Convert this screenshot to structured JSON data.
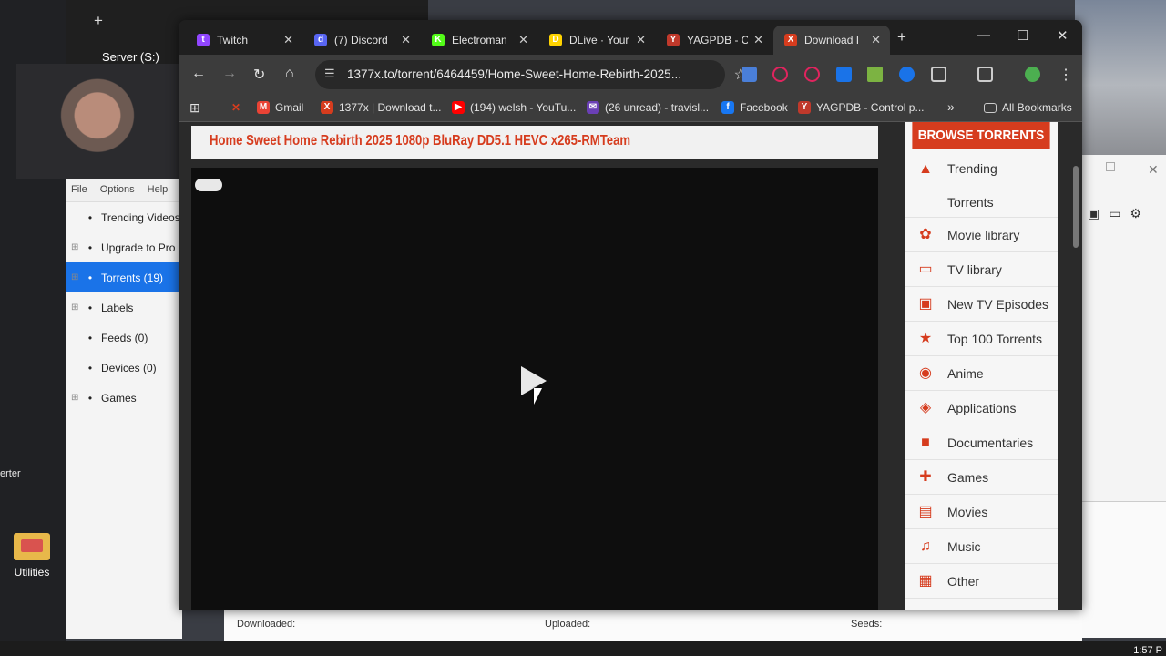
{
  "desktop": {
    "utilities_label": "Utilities",
    "erter_text": "erter",
    "server_label": "Server (S:)"
  },
  "utorrent": {
    "menu": [
      "File",
      "Options",
      "Help"
    ],
    "items": [
      {
        "label": "Trending Videos",
        "icon": "lightning-icon",
        "expand": ""
      },
      {
        "label": "Upgrade to Pro",
        "icon": "utorrent-icon",
        "expand": "⊞"
      },
      {
        "label": "Torrents (19)",
        "icon": "torrents-icon",
        "expand": "⊞",
        "selected": true
      },
      {
        "label": "Labels",
        "icon": "tag-icon",
        "expand": "⊞"
      },
      {
        "label": "Feeds (0)",
        "icon": "rss-icon",
        "expand": ""
      },
      {
        "label": "Devices (0)",
        "icon": "device-icon",
        "expand": ""
      },
      {
        "label": "Games",
        "icon": "gamepad-icon",
        "expand": "⊞"
      }
    ]
  },
  "details": {
    "downloaded": "Downloaded:",
    "uploaded": "Uploaded:",
    "seeds": "Seeds:"
  },
  "browser": {
    "tabs": [
      {
        "title": "Twitch",
        "color": "#9146ff",
        "glyph": "t"
      },
      {
        "title": "(7) Discord",
        "color": "#5865f2",
        "glyph": "d"
      },
      {
        "title": "Electroman",
        "color": "#53fc18",
        "glyph": "K"
      },
      {
        "title": "DLive · Your",
        "color": "#ffd300",
        "glyph": "D"
      },
      {
        "title": "YAGPDB - C",
        "color": "#c0392b",
        "glyph": "Y"
      },
      {
        "title": "Download I",
        "color": "#d63c1e",
        "glyph": "X",
        "active": true
      }
    ],
    "url": "1377x.to/torrent/6464459/Home-Sweet-Home-Rebirth-2025...",
    "bookmarks": [
      {
        "label": "Gmail",
        "color": "#ea4335",
        "glyph": "M"
      },
      {
        "label": "1377x | Download t...",
        "color": "#d63c1e",
        "glyph": "X"
      },
      {
        "label": "(194) welsh - YouTu...",
        "color": "#ff0000",
        "glyph": "▶"
      },
      {
        "label": "(26 unread) - travisl...",
        "color": "#6a3fb5",
        "glyph": "✉"
      },
      {
        "label": "Facebook",
        "color": "#1877f2",
        "glyph": "f"
      },
      {
        "label": "YAGPDB - Control p...",
        "color": "#c0392b",
        "glyph": "Y"
      }
    ],
    "all_bookmarks": "All Bookmarks"
  },
  "page": {
    "torrent_title": "Home Sweet Home Rebirth 2025 1080p BluRay DD5.1 HEVC x265-RMTeam",
    "browse_header": "BROWSE TORRENTS",
    "categories": [
      {
        "label": "Trending Torrents",
        "icon": "trending-chart-icon",
        "glyph": "▲"
      },
      {
        "label": "Movie library",
        "icon": "film-reel-icon",
        "glyph": "✿"
      },
      {
        "label": "TV library",
        "icon": "tv-icon",
        "glyph": "▭"
      },
      {
        "label": "New TV Episodes",
        "icon": "new-tv-icon",
        "glyph": "▣"
      },
      {
        "label": "Top 100 Torrents",
        "icon": "top-badge-icon",
        "glyph": "★"
      },
      {
        "label": "Anime",
        "icon": "anime-icon",
        "glyph": "◉"
      },
      {
        "label": "Applications",
        "icon": "windows-icon",
        "glyph": "◈"
      },
      {
        "label": "Documentaries",
        "icon": "camera-icon",
        "glyph": "■"
      },
      {
        "label": "Games",
        "icon": "gamepad-icon",
        "glyph": "✚"
      },
      {
        "label": "Movies",
        "icon": "clapper-icon",
        "glyph": "▤"
      },
      {
        "label": "Music",
        "icon": "music-note-icon",
        "glyph": "♫"
      },
      {
        "label": "Other",
        "icon": "box-icon",
        "glyph": "▦"
      }
    ]
  },
  "taskbar": {
    "clock": "1:57 P"
  }
}
